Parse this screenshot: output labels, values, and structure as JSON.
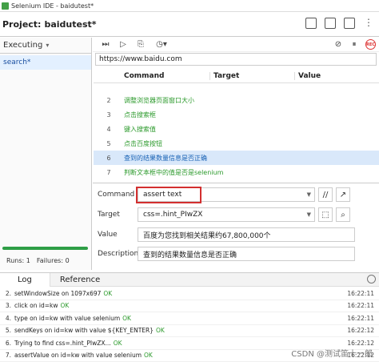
{
  "window": {
    "title": "Selenium IDE - baidutest*"
  },
  "project": {
    "label": "Project:",
    "name": "baidutest*"
  },
  "left_panel": {
    "executing_label": "Executing",
    "suite_name": "search*",
    "runs_label": "Runs: 1",
    "failures_label": "Failures: 0",
    "progress": 1.0
  },
  "url": "https://www.baidu.com",
  "table": {
    "headers": [
      "Command",
      "Target",
      "Value"
    ],
    "rows": [
      {
        "num": "2",
        "command": "调整浏览器页面窗口大小"
      },
      {
        "num": "3",
        "command": "点击搜索框"
      },
      {
        "num": "4",
        "command": "键入搜索值"
      },
      {
        "num": "5",
        "command": "点击百度按钮"
      },
      {
        "num": "6",
        "command": "查到的结果数量信息是否正确",
        "selected": true
      },
      {
        "num": "7",
        "command": "判断文本框中的值是否是selenium"
      }
    ]
  },
  "editor": {
    "command_label": "Command",
    "command_value": "assert text",
    "target_label": "Target",
    "target_value": "css=.hint_PIwZX",
    "value_label": "Value",
    "value_value": "百度为您找到相关结果约67,800,000个",
    "description_label": "Description",
    "description_value": "查到的结果数量信息是否正确",
    "highlight_color": "#d32f2f"
  },
  "bottom": {
    "tabs": [
      "Log",
      "Reference"
    ],
    "log": [
      {
        "n": "2.",
        "text": "setWindowSize on 1097x697",
        "ok": "OK",
        "time": "16:22:11"
      },
      {
        "n": "3.",
        "text": "click on id=kw",
        "ok": "OK",
        "time": "16:22:11"
      },
      {
        "n": "4.",
        "text": "type on id=kw with value selenium",
        "ok": "OK",
        "time": "16:22:11"
      },
      {
        "n": "5.",
        "text": "sendKeys on id=kw with value ${KEY_ENTER}",
        "ok": "OK",
        "time": "16:22:12"
      },
      {
        "n": "6.",
        "text": "Trying to find css=.hint_PIwZX...",
        "ok": "OK",
        "time": "16:22:12"
      },
      {
        "n": "7.",
        "text": "assertValue on id=kw with value selenium",
        "ok": "OK",
        "time": "16:22:12"
      }
    ]
  },
  "watermark": "CSDN @测试笛十一郎",
  "icons": [
    "app-icon",
    "new-project-icon",
    "open-icon",
    "save-icon",
    "more-icon",
    "run-all-icon",
    "run-icon",
    "debug-icon",
    "speed-icon",
    "disable-breakpoints-icon",
    "pause-on-exception-icon",
    "record-icon",
    "comment-icon",
    "open-window-icon",
    "select-target-icon",
    "search-icon",
    "clear-icon"
  ]
}
